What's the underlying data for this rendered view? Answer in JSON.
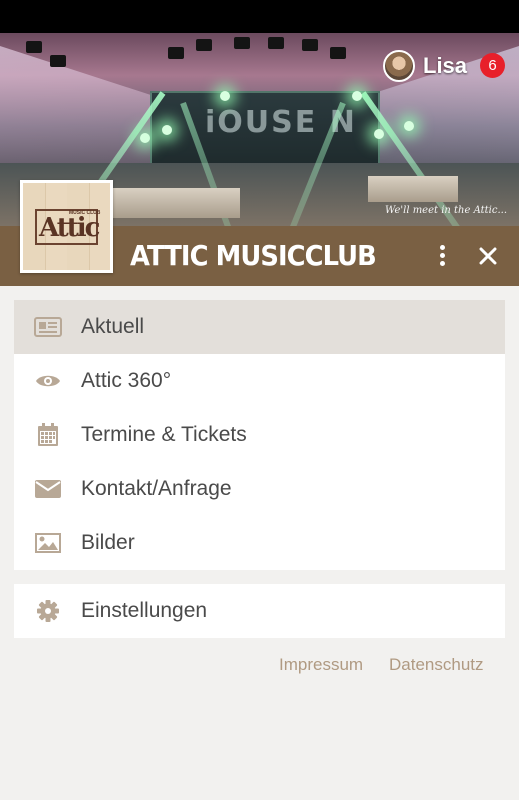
{
  "header": {
    "user": {
      "name": "Lisa",
      "notifications": "6"
    },
    "brand_title": "ATTIC MUSICCLUB",
    "hero_tagline": "We'll meet in the Attic...",
    "logo_text": "Attic",
    "logo_subtext": "MUSIC CLUB"
  },
  "menu": {
    "items": [
      {
        "label": "Aktuell",
        "icon": "newspaper-icon",
        "active": true
      },
      {
        "label": "Attic 360°",
        "icon": "eye-icon",
        "active": false
      },
      {
        "label": "Termine & Tickets",
        "icon": "calendar-icon",
        "active": false
      },
      {
        "label": "Kontakt/Anfrage",
        "icon": "envelope-icon",
        "active": false
      },
      {
        "label": "Bilder",
        "icon": "image-icon",
        "active": false
      }
    ],
    "settings": {
      "label": "Einstellungen",
      "icon": "gear-icon"
    }
  },
  "footer": {
    "impressum": "Impressum",
    "datenschutz": "Datenschutz"
  },
  "colors": {
    "brand_bar": "#7a6043",
    "active_item": "#e3dfda",
    "icon": "#b8a896",
    "footer_link": "#b09a82",
    "badge": "#e8202a",
    "background": "#f2f1ef"
  }
}
